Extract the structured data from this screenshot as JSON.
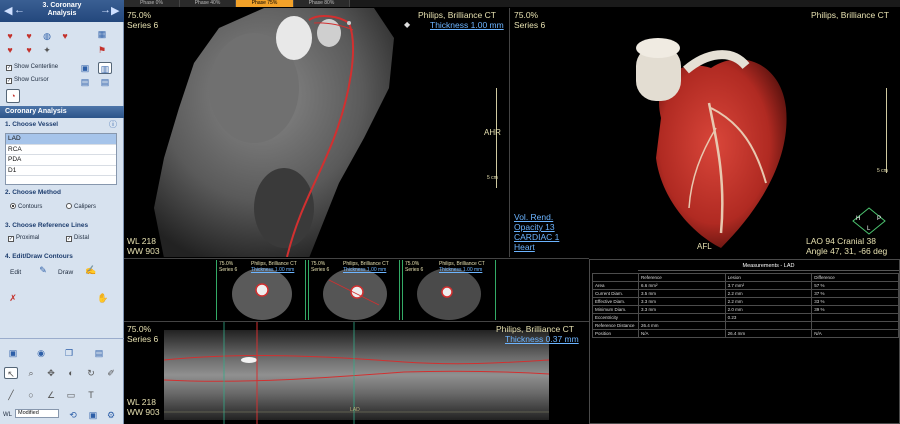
{
  "nav": {
    "title_line1": "3. Coronary",
    "title_line2": "Analysis"
  },
  "options": {
    "show_centerline": "Show Centerline",
    "show_cursor": "Show Cursor"
  },
  "panel": {
    "header": "Coronary Analysis",
    "step1": "1. Choose Vessel",
    "vessels": [
      "LAD",
      "RCA",
      "PDA",
      "D1"
    ],
    "selected_vessel": "LAD",
    "step2": "2. Choose Method",
    "method_contours": "Contours",
    "method_calipers": "Calipers",
    "step3": "3. Choose Reference Lines",
    "ref_proximal": "Proximal",
    "ref_distal": "Distal",
    "step4": "4. Edit/Draw Contours",
    "edit": "Edit",
    "draw": "Draw"
  },
  "wl_label": "WL",
  "wl_value": "Modified",
  "phases": [
    "Phase 0%",
    "Phase 40%",
    "Phase 75%",
    "Phase 80%"
  ],
  "active_phase": "Phase 75%",
  "view_curved": {
    "phase": "75.0%",
    "series": "Series 6",
    "scanner": "Philips, Brilliance CT",
    "thickness": "Thickness 1.00 mm",
    "orient": "AHR",
    "scale": "5 cm",
    "wl": "WL    218",
    "ww": "WW   903"
  },
  "view_3d": {
    "phase": "75.0%",
    "series": "Series 6",
    "scanner": "Philips, Brilliance CT",
    "render": "Vol. Rend.",
    "opacity": "Opacity 13",
    "preset": "CARDIAC 1",
    "organ": "Heart",
    "label_afl": "AFL",
    "lao": "LAO 94 Cranial 38",
    "angle": "Angle 47, 31, -66  deg",
    "scale": "5 cm",
    "cube_h": "H",
    "cube_p": "P",
    "cube_l": "L"
  },
  "cross_sections": [
    {
      "phase": "75.0%",
      "series": "Series 6",
      "scanner": "Philips, Brilliance CT",
      "thick": "Thickness 1.00 mm"
    },
    {
      "phase": "75.0%",
      "series": "Series 6",
      "scanner": "Philips, Brilliance CT",
      "thick": "Thickness 1.00 mm"
    },
    {
      "phase": "75.0%",
      "series": "Series 6",
      "scanner": "Philips, Brilliance CT",
      "thick": "Thickness 1.00 mm"
    }
  ],
  "view_straight": {
    "phase": "75.0%",
    "series": "Series 6",
    "scanner": "Philips, Brilliance CT",
    "thickness": "Thickness 0.37 mm",
    "wl": "WL   218",
    "ww": "WW   903",
    "vessel": "LAD"
  },
  "measurements": {
    "title": "Measurements - LAD",
    "columns": [
      "Reference",
      "Lesion",
      "Difference"
    ],
    "rows": [
      [
        "Area",
        "6.6 mm²",
        "3.7 mm²",
        "57 %"
      ],
      [
        "Current Diam.",
        "3.5 mm",
        "2.2 mm",
        "37 %"
      ],
      [
        "Effective Diam.",
        "3.3 mm",
        "2.2 mm",
        "33 %"
      ],
      [
        "Minimum Diam.",
        "3.3 mm",
        "2.0 mm",
        "39 %"
      ],
      [
        "Eccentricity",
        "",
        "0.23",
        ""
      ],
      [
        "Reference Distance",
        "26.4 mm",
        "",
        ""
      ],
      [
        "Position",
        "N/A",
        "26.4 mm",
        "N/A"
      ]
    ]
  },
  "colors": {
    "accent_tab": "#f3a229",
    "centerline": "#d23030",
    "link_text": "#6cb4ff",
    "overlay_text": "#e6e0b0"
  }
}
